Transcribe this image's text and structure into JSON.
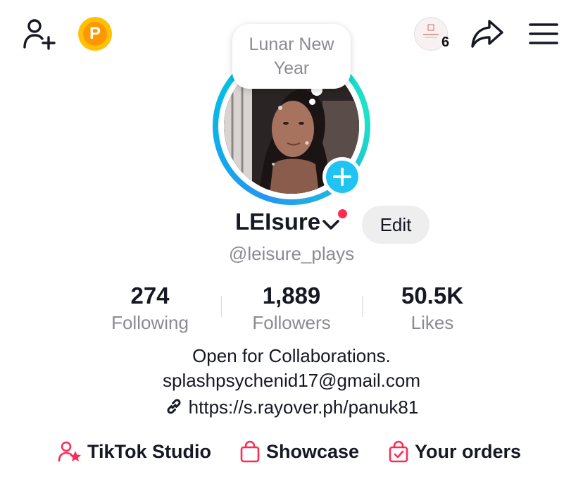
{
  "topbar": {
    "points_letter": "P",
    "notification_count": "6"
  },
  "bubble": {
    "line1": "Lunar New",
    "line2": "Year"
  },
  "profile": {
    "display_name": "LEIsure",
    "handle": "@leisure_plays",
    "edit_label": "Edit"
  },
  "stats": [
    {
      "value": "274",
      "label": "Following"
    },
    {
      "value": "1,889",
      "label": "Followers"
    },
    {
      "value": "50.5K",
      "label": "Likes"
    }
  ],
  "bio": {
    "line1": "Open for Collaborations.",
    "line2": "splashpsychenid17@gmail.com",
    "link": "https://s.rayover.ph/panuk81"
  },
  "actions": [
    {
      "label": "TikTok Studio",
      "icon": "person-star-icon"
    },
    {
      "label": "Showcase",
      "icon": "shopping-bag-icon"
    },
    {
      "label": "Your orders",
      "icon": "order-bag-check-icon"
    }
  ],
  "colors": {
    "accent_red": "#fe2c55",
    "story_plus": "#20c4f2",
    "ring_start": "#2196f3",
    "ring_end": "#20e3c4",
    "points_gold": "#ffc107"
  }
}
